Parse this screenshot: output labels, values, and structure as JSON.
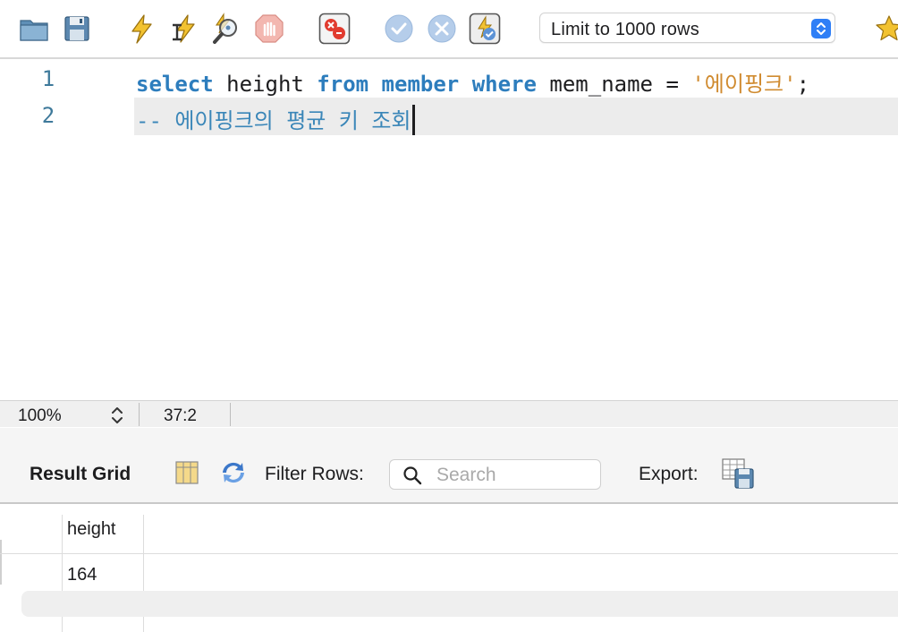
{
  "toolbar": {
    "buttons": [
      {
        "name": "open-file-icon"
      },
      {
        "name": "save-icon"
      },
      {
        "name": "execute-all-icon"
      },
      {
        "name": "execute-current-icon"
      },
      {
        "name": "explain-icon"
      },
      {
        "name": "stop-icon"
      },
      {
        "name": "toggle-error-icon"
      },
      {
        "name": "commit-icon"
      },
      {
        "name": "rollback-icon"
      },
      {
        "name": "autocommit-icon"
      },
      {
        "name": "bookmark-star-icon"
      }
    ],
    "limit_select": {
      "selected": "Limit to 1000 rows"
    }
  },
  "editor": {
    "lines": [
      {
        "number": "1",
        "kw_select": "select",
        "t_height": " height ",
        "kw_from": "from",
        "t_sp1": " ",
        "kw_member": "member",
        "t_sp2": " ",
        "kw_where": "where",
        "t_cond": " mem_name = ",
        "str_val": "'에이핑크'",
        "t_semi": ";"
      },
      {
        "number": "2",
        "comment": "-- 에이핑크의 평균 키 조회"
      }
    ]
  },
  "status": {
    "zoom": "100%",
    "cursor": "37:2"
  },
  "result": {
    "title": "Result Grid",
    "filter_label": "Filter Rows:",
    "search_placeholder": "Search",
    "export_label": "Export:",
    "columns": [
      "height"
    ],
    "rows": [
      [
        "164"
      ]
    ]
  }
}
